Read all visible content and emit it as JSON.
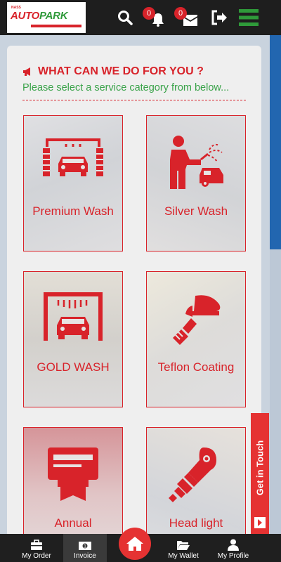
{
  "header": {
    "logo_small": "NASS",
    "logo_auto": "AUTO",
    "logo_park": "PARK",
    "notifications_count": "0",
    "messages_count": "0"
  },
  "main": {
    "heading": "WHAT CAN WE DO FOR YOU ?",
    "subheading": "Please select a service category from below...",
    "services": [
      {
        "label": "Premium Wash",
        "icon": "car-wash-icon"
      },
      {
        "label": "Silver Wash",
        "icon": "pressure-washer-icon"
      },
      {
        "label": "GOLD WASH",
        "icon": "car-wash-gantry-icon"
      },
      {
        "label": "Teflon Coating",
        "icon": "polisher-icon"
      },
      {
        "label": "Annual",
        "icon": "membership-card-icon"
      },
      {
        "label": "Head light",
        "icon": "headlight-bulb-icon"
      }
    ]
  },
  "get_in_touch": "Get in Touch",
  "bottom_nav": {
    "my_order": "My Order",
    "invoice": "Invoice",
    "my_wallet": "My Wallet",
    "my_profile": "My Profile"
  },
  "colors": {
    "accent": "#d8232a",
    "green": "#3aa34a",
    "header_bg": "#1e1e1e"
  }
}
